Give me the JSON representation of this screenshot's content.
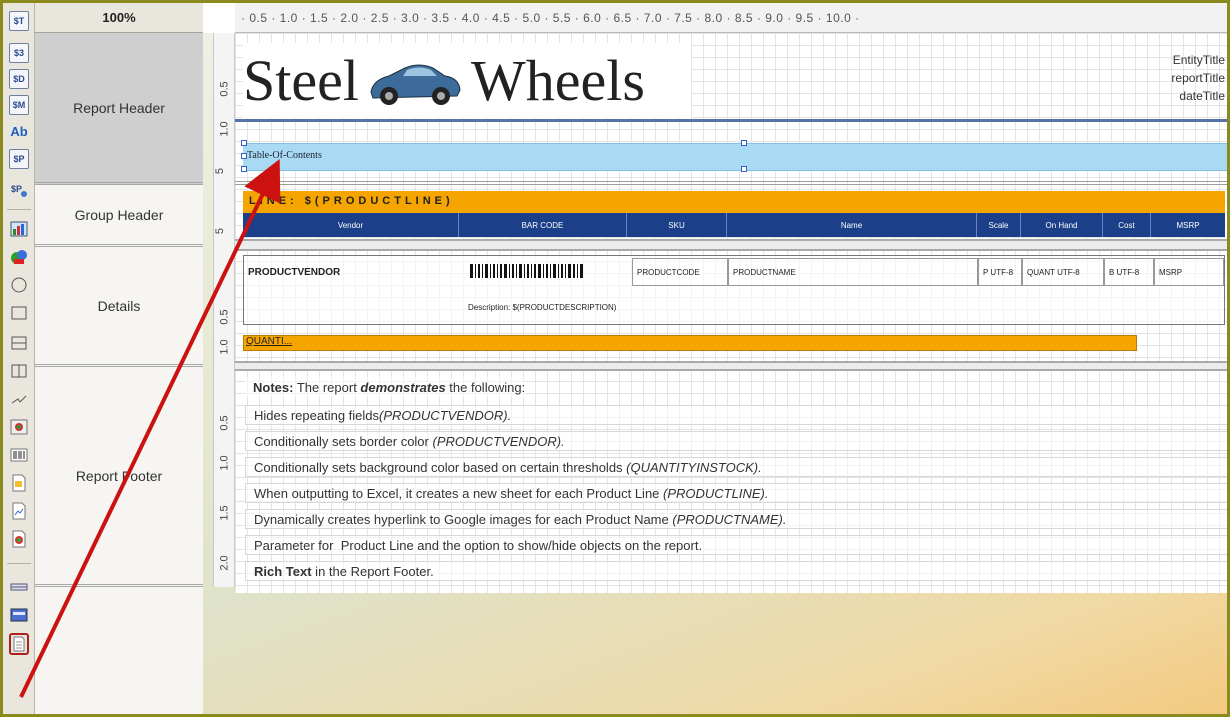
{
  "zoom": "100%",
  "ruler_labels": "· 0.5 · 1.0 · 1.5 · 2.0 · 2.5 · 3.0 · 3.5 · 4.0 · 4.5 · 5.0 · 5.5 · 6.0 · 6.5 · 7.0 · 7.5 · 8.0 · 8.5 · 9.0 · 9.5 · 10.0 ·",
  "vruler": {
    "h05": "0.5",
    "h10": "1.0",
    "h5": "5",
    "g5": "5",
    "d05": "0.5",
    "d10": "1.0",
    "f05": "0.5",
    "f10": "1.0",
    "f15": "1.5",
    "f20": "2.0"
  },
  "sections": {
    "report_header": "Report Header",
    "group_header": "Group Header",
    "details": "Details",
    "report_footer": "Report Footer"
  },
  "toolbar": {
    "items": [
      "$T",
      "$3",
      "$D",
      "$M",
      "Ab",
      "$P",
      "$P",
      "chart",
      "shapes",
      "ellipse",
      "rectangle",
      "horizontal-split",
      "vertical-split",
      "line",
      "image",
      "barcode",
      "sub-report",
      "sub-chart",
      "image-field",
      "horizontal-line",
      "banner",
      "table-of-contents"
    ]
  },
  "header": {
    "logo_left": "Steel",
    "logo_right": "Wheels",
    "entity_title": "EntityTitle",
    "report_title": "reportTitle",
    "date_title": "dateTitle",
    "toc": "Table-Of-Contents"
  },
  "group": {
    "line": "LINE: $(PRODUCTLINE)",
    "columns": [
      "Vendor",
      "BAR CODE",
      "SKU",
      "Name",
      "Scale",
      "On Hand",
      "Cost",
      "MSRP"
    ]
  },
  "details": {
    "vendor": "PRODUCTVENDOR",
    "product_code": "PRODUCTCODE",
    "product_name": "PRODUCTNAME",
    "scale": "P UTF-8",
    "quant": "QUANT UTF-8",
    "cost": "B UTF-8",
    "msrp": "MSRP",
    "description": "Description: $(PRODUCTDESCRIPTION)",
    "quanti": "QUANTI..."
  },
  "notes": {
    "intro_lead": "Notes:",
    "intro_mid": " The report ",
    "intro_em": "demonstrates",
    "intro_tail": " the following:",
    "lines": [
      {
        "text": "Hides repeating fields",
        "em": "(PRODUCTVENDOR)."
      },
      {
        "text": "Conditionally sets border color ",
        "em": "(PRODUCTVENDOR)."
      },
      {
        "text": "Conditionally sets background color based on certain thresholds ",
        "em": "(QUANTITYINSTOCK)."
      },
      {
        "text": "When outputting to Excel, it creates a new sheet for each Product Line ",
        "em": "(PRODUCTLINE)."
      },
      {
        "text": "Dynamically creates hyperlink to Google images for each Product Name ",
        "em": "(PRODUCTNAME)."
      },
      {
        "text": "Parameter for  Product Line and the option to show/hide objects on the report.",
        "em": ""
      }
    ],
    "rich_bold": "Rich Text",
    "rich_tail": " in the Report Footer."
  },
  "colors": {
    "accent_orange": "#f5a400",
    "header_blue": "#1b3f88",
    "toc_blue": "#a9daf3",
    "arrow_red": "#cc1111"
  }
}
